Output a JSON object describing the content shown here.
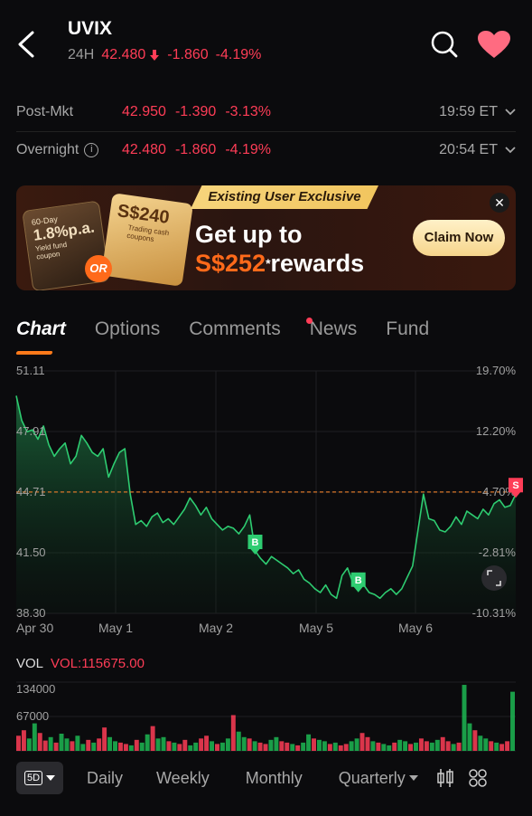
{
  "header": {
    "ticker": "UVIX",
    "session": "24H",
    "price": "42.480",
    "change": "-1.860",
    "change_pct": "-4.19%"
  },
  "sessions": [
    {
      "label": "Post-Mkt",
      "price": "42.950",
      "change": "-1.390",
      "change_pct": "-3.13%",
      "time": "19:59 ET"
    },
    {
      "label": "Overnight",
      "price": "42.480",
      "change": "-1.860",
      "change_pct": "-4.19%",
      "time": "20:54 ET"
    }
  ],
  "banner": {
    "tag": "Existing User Exclusive",
    "headline_line1": "Get up to",
    "headline_amount": "S$252",
    "headline_suffix": "rewards",
    "card1_top": "60-Day",
    "card1_rate": "1.8%p.a.",
    "card1_desc": "Yield fund coupon",
    "card2_amount": "S$240",
    "card2_desc": "Trading cash coupons",
    "or": "OR",
    "cta": "Claim Now"
  },
  "tabs": [
    "Chart",
    "Options",
    "Comments",
    "News",
    "Fund"
  ],
  "chart_data": {
    "type": "line",
    "y_labels_left": [
      "51.11",
      "47.91",
      "44.71",
      "41.50",
      "38.30"
    ],
    "y_labels_right": [
      "19.70%",
      "12.20%",
      "4.70%",
      "-2.81%",
      "-10.31%"
    ],
    "x_labels": [
      "Apr 30",
      "May 1",
      "May 2",
      "May 5",
      "May 6"
    ],
    "ylim": [
      38.3,
      51.11
    ],
    "reference_line": 44.71,
    "series": [
      {
        "values": [
          49.8,
          48.5,
          47.9,
          48.0,
          47.5,
          48.2,
          47.2,
          46.6,
          47.0,
          47.3,
          46.2,
          46.6,
          47.7,
          47.3,
          46.8,
          46.6,
          47.0,
          45.5,
          46.2,
          46.8,
          47.0,
          44.6,
          43.0,
          43.2,
          42.9,
          43.4,
          43.6,
          43.1,
          43.3,
          43.0,
          43.4,
          43.8,
          44.4,
          44.0,
          43.5,
          43.9,
          43.3,
          43.0,
          42.7,
          42.9,
          42.8,
          42.5,
          42.9,
          43.5,
          41.6,
          41.2,
          40.9,
          41.3,
          41.1,
          40.9,
          40.7,
          40.4,
          40.6,
          40.1,
          39.9,
          39.6,
          39.4,
          39.8,
          39.3,
          39.1,
          40.3,
          40.7,
          39.9,
          39.6,
          39.8,
          39.4,
          39.3,
          39.1,
          39.4,
          39.6,
          39.3,
          39.6,
          40.2,
          40.8,
          42.7,
          44.6,
          43.3,
          43.2,
          42.7,
          42.6,
          42.9,
          43.4,
          43.0,
          43.7,
          43.5,
          43.3,
          43.8,
          43.5,
          44.1,
          44.3,
          43.9,
          44.0,
          44.6
        ]
      }
    ],
    "markers": [
      {
        "label": "B",
        "x_index": 44
      },
      {
        "label": "B",
        "x_index": 63
      },
      {
        "label": "S",
        "x_index": 92
      }
    ]
  },
  "volume": {
    "label": "VOL",
    "value": "VOL:115675.00",
    "y_labels": [
      "134000",
      "67000"
    ],
    "bars": [
      22,
      30,
      18,
      40,
      26,
      15,
      20,
      12,
      25,
      18,
      14,
      22,
      10,
      16,
      12,
      18,
      34,
      20,
      14,
      12,
      10,
      8,
      16,
      12,
      24,
      36,
      18,
      20,
      14,
      12,
      10,
      16,
      8,
      12,
      18,
      22,
      14,
      10,
      12,
      18,
      52,
      28,
      20,
      18,
      14,
      12,
      10,
      16,
      20,
      14,
      12,
      10,
      8,
      12,
      24,
      18,
      16,
      14,
      10,
      12,
      8,
      10,
      14,
      18,
      26,
      20,
      14,
      12,
      10,
      8,
      12,
      16,
      14,
      10,
      12,
      18,
      14,
      12,
      16,
      20,
      14,
      10,
      12,
      96,
      40,
      30,
      22,
      18,
      14,
      12,
      10,
      14,
      86
    ],
    "colors": {
      "up": "#1db954",
      "down": "#ff3d57"
    }
  },
  "footer": {
    "period_selected": "5D",
    "periods": [
      "Daily",
      "Weekly",
      "Monthly",
      "Quarterly"
    ]
  },
  "colors": {
    "accent": "#ff7a1a",
    "down": "#ff3d57",
    "up": "#1db954",
    "line": "#2ecc71",
    "background": "#0b0b0d"
  }
}
